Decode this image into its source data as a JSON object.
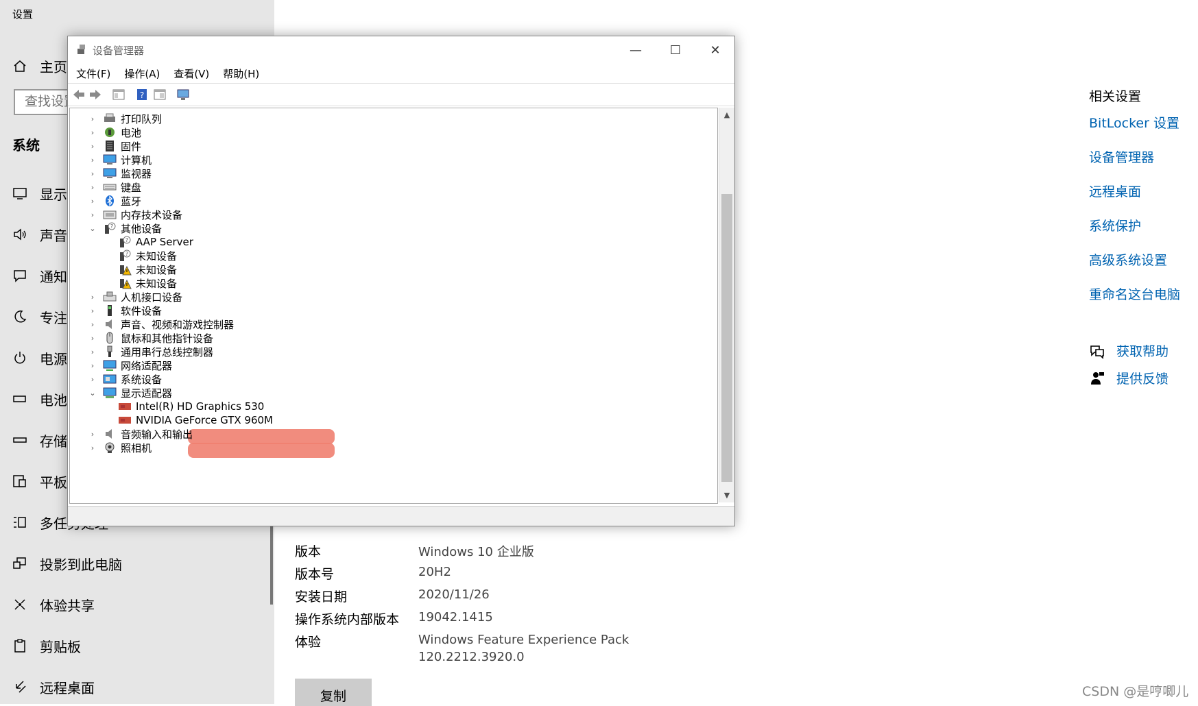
{
  "settings": {
    "app_title": "设置",
    "home": "主页",
    "search_placeholder": "查找设置",
    "section": "系统",
    "items": [
      "显示",
      "声音",
      "通知和操作",
      "专注助手",
      "电源和睡眠",
      "电池",
      "存储",
      "平板电脑",
      "多任务处理",
      "投影到此电脑",
      "体验共享",
      "剪贴板",
      "远程桌面"
    ]
  },
  "device_manager": {
    "title": "设备管理器",
    "menu": [
      "文件(F)",
      "操作(A)",
      "查看(V)",
      "帮助(H)"
    ],
    "tree": [
      {
        "label": "打印队列",
        "expander": "›"
      },
      {
        "label": "电池",
        "expander": "›"
      },
      {
        "label": "固件",
        "expander": "›"
      },
      {
        "label": "计算机",
        "expander": "›"
      },
      {
        "label": "监视器",
        "expander": "›"
      },
      {
        "label": "键盘",
        "expander": "›"
      },
      {
        "label": "蓝牙",
        "expander": "›"
      },
      {
        "label": "内存技术设备",
        "expander": "›"
      },
      {
        "label": "其他设备",
        "expander": "⌄"
      },
      {
        "label": "AAP Server",
        "expander": ""
      },
      {
        "label": "未知设备",
        "expander": ""
      },
      {
        "label": "未知设备",
        "expander": ""
      },
      {
        "label": "未知设备",
        "expander": ""
      },
      {
        "label": "人机接口设备",
        "expander": "›"
      },
      {
        "label": "软件设备",
        "expander": "›"
      },
      {
        "label": "声音、视频和游戏控制器",
        "expander": "›"
      },
      {
        "label": "鼠标和其他指针设备",
        "expander": "›"
      },
      {
        "label": "通用串行总线控制器",
        "expander": "›"
      },
      {
        "label": "网络适配器",
        "expander": "›"
      },
      {
        "label": "系统设备",
        "expander": "›"
      },
      {
        "label": "显示适配器",
        "expander": "⌄"
      },
      {
        "label": "Intel(R) HD Graphics 530",
        "expander": ""
      },
      {
        "label": "NVIDIA GeForce GTX 960M",
        "expander": ""
      },
      {
        "label": "音频输入和输出",
        "expander": "›"
      },
      {
        "label": "照相机",
        "expander": "›"
      }
    ]
  },
  "related": {
    "heading": "相关设置",
    "links": [
      "BitLocker 设置",
      "设备管理器",
      "远程桌面",
      "系统保护",
      "高级系统设置",
      "重命名这台电脑"
    ],
    "help": "获取帮助",
    "feedback": "提供反馈"
  },
  "info": [
    {
      "label": "版本",
      "value": "Windows 10 企业版"
    },
    {
      "label": "版本号",
      "value": "20H2"
    },
    {
      "label": "安装日期",
      "value": "2020/11/26"
    },
    {
      "label": "操作系统内部版本",
      "value": "19042.1415"
    },
    {
      "label": "体验",
      "value": "Windows Feature Experience Pack"
    }
  ],
  "info_extra": "120.2212.3920.0",
  "copy_label": "复制",
  "watermark": "CSDN @是哼唧儿",
  "accent": "#0063b1"
}
